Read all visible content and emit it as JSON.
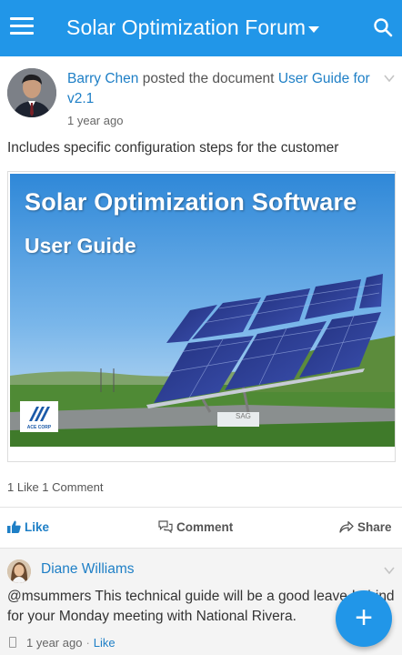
{
  "appbar": {
    "title": "Solar Optimization Forum",
    "menu_icon": "hamburger-menu-icon",
    "dropdown_icon": "caret-down-icon",
    "search_icon": "search-icon",
    "color": "#2196e8"
  },
  "post": {
    "author": "Barry Chen",
    "action": "posted the document",
    "document_title": "User Guide for v2.1",
    "time": "1 year ago",
    "text": "Includes specific configuration steps for the customer",
    "document_preview": {
      "title": "Solar Optimization Software",
      "subtitle": "User Guide",
      "logo_text": "ACE CORP",
      "panel_label": "SAG"
    },
    "counts": "1 Like  1 Comment"
  },
  "actions": {
    "like": "Like",
    "comment": "Comment",
    "share": "Share"
  },
  "comment": {
    "author": "Diane Williams",
    "text": "@msummers This technical guide will be a good leave-behind for your Monday meeting with National Rivera.",
    "time": "1 year ago",
    "like": "Like"
  },
  "fab": {
    "label": "+",
    "icon": "plus-icon"
  },
  "colors": {
    "accent": "#2196e8",
    "link": "#1e7fc6"
  }
}
